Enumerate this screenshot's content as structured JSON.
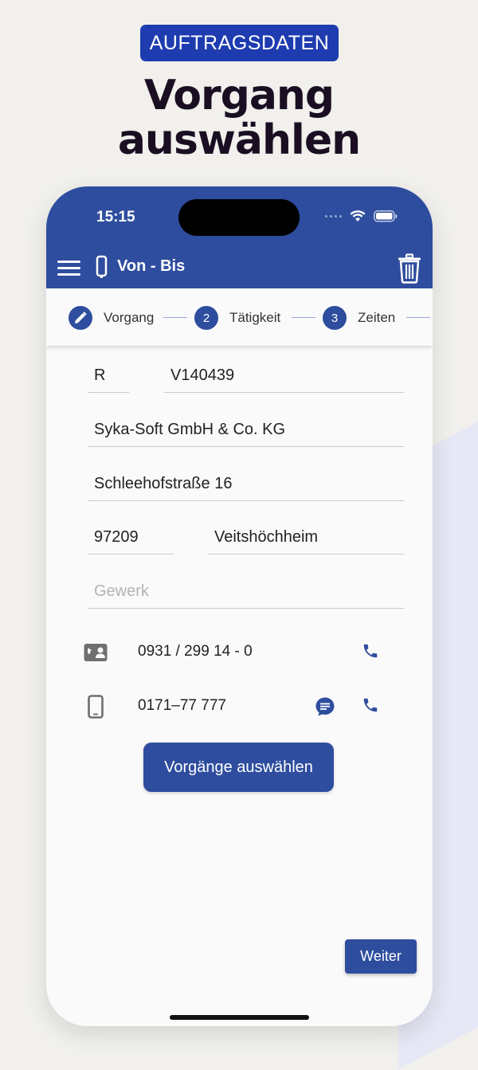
{
  "header": {
    "badge": "AUFTRAGSDATEN",
    "title_line1": "Vorgang",
    "title_line2": "auswählen"
  },
  "status_bar": {
    "time": "15:15"
  },
  "app_bar": {
    "title": "Von - Bis",
    "menu_icon": "hamburger-icon",
    "device_icon": "phone-outline-icon",
    "delete_icon": "trash-icon"
  },
  "stepper": {
    "steps": [
      {
        "indicator": "",
        "label": "Vorgang",
        "icon": "pencil-icon"
      },
      {
        "indicator": "2",
        "label": "Tätigkeit"
      },
      {
        "indicator": "3",
        "label": "Zeiten"
      }
    ]
  },
  "form": {
    "type": "R",
    "number": "V140439",
    "company": "Syka-Soft GmbH & Co. KG",
    "street": "Schleehofstraße 16",
    "zip": "97209",
    "city": "Veitshöchheim",
    "trade_placeholder": "Gewerk"
  },
  "contacts": {
    "landline": "0931 / 299 14 - 0",
    "mobile": "0171–77 777"
  },
  "buttons": {
    "select_operations": "Vorgänge auswählen",
    "next": "Weiter"
  },
  "colors": {
    "primary": "#2e4d9e",
    "badge": "#1e3cb0",
    "headline": "#1a0f22",
    "background": "#f1f0ec"
  }
}
